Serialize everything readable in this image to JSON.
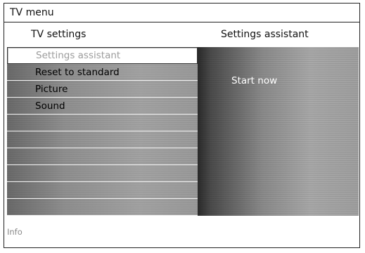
{
  "menu": {
    "title": "TV menu",
    "left_header": "TV settings",
    "right_header": "Settings assistant",
    "items": [
      {
        "label": "Settings assistant"
      },
      {
        "label": "Reset to standard"
      },
      {
        "label": "Picture"
      },
      {
        "label": "Sound"
      },
      {
        "label": ""
      },
      {
        "label": ""
      },
      {
        "label": ""
      },
      {
        "label": ""
      },
      {
        "label": ""
      },
      {
        "label": ""
      }
    ],
    "selected_index": 0,
    "right_options": [
      {
        "label": "Start now"
      }
    ]
  },
  "info": {
    "label": "Info"
  }
}
